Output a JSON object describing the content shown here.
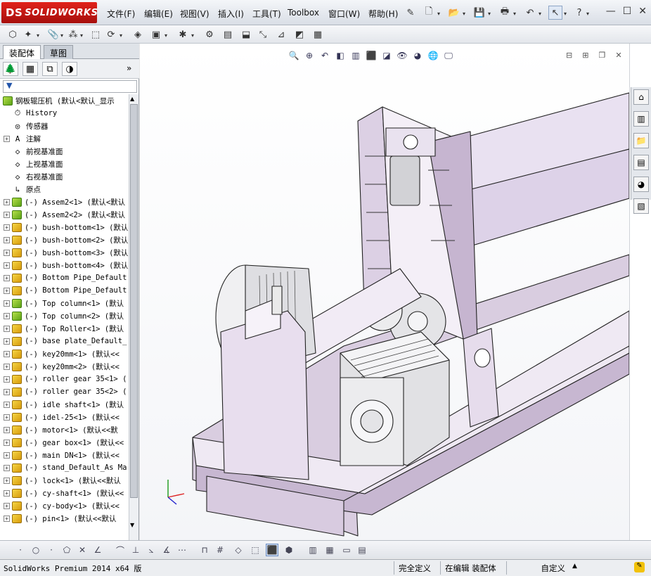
{
  "app": {
    "brand": "SOLIDWORKS",
    "brand_prefix": "DS",
    "accent": "#d51a14"
  },
  "menu": {
    "items": [
      {
        "label": "文件(F)"
      },
      {
        "label": "编辑(E)"
      },
      {
        "label": "视图(V)"
      },
      {
        "label": "插入(I)"
      },
      {
        "label": "工具(T)"
      },
      {
        "label": "Toolbox"
      },
      {
        "label": "窗口(W)"
      },
      {
        "label": "帮助(H)"
      }
    ]
  },
  "panel": {
    "tabs": [
      {
        "label": "装配体",
        "active": true
      },
      {
        "label": "草图",
        "active": false
      }
    ],
    "tree_root": "钢板辊压机 (默认<默认_显示",
    "tree": [
      {
        "label": "History",
        "icon": "history-icon",
        "expand": false
      },
      {
        "label": "传感器",
        "icon": "sensor-icon",
        "expand": false
      },
      {
        "label": "注解",
        "icon": "annotation-icon",
        "expand": true
      },
      {
        "label": "前视基准面",
        "icon": "plane-icon",
        "expand": false
      },
      {
        "label": "上视基准面",
        "icon": "plane-icon",
        "expand": false
      },
      {
        "label": "右视基准面",
        "icon": "plane-icon",
        "expand": false
      },
      {
        "label": "原点",
        "icon": "origin-icon",
        "expand": false
      },
      {
        "label": "(-) Assem2<1> (默认<默认",
        "icon": "asm",
        "expand": true
      },
      {
        "label": "(-) Assem2<2> (默认<默认",
        "icon": "asm",
        "expand": true
      },
      {
        "label": "(-) bush-bottom<1> (默认",
        "icon": "part",
        "expand": true
      },
      {
        "label": "(-) bush-bottom<2> (默认",
        "icon": "part",
        "expand": true
      },
      {
        "label": "(-) bush-bottom<3> (默认",
        "icon": "part",
        "expand": true
      },
      {
        "label": "(-) bush-bottom<4> (默认",
        "icon": "part",
        "expand": true
      },
      {
        "label": "(-) Bottom Pipe_Default",
        "icon": "part",
        "expand": true
      },
      {
        "label": "(-) Bottom Pipe_Default",
        "icon": "part",
        "expand": true
      },
      {
        "label": "(-) Top column<1> (默认",
        "icon": "asm",
        "expand": true
      },
      {
        "label": "(-) Top column<2> (默认",
        "icon": "asm",
        "expand": true
      },
      {
        "label": "(-) Top Roller<1> (默认",
        "icon": "part",
        "expand": true
      },
      {
        "label": "(-) base plate_Default_",
        "icon": "part",
        "expand": true
      },
      {
        "label": "(-) key20mm<1> (默认<<",
        "icon": "part",
        "expand": true
      },
      {
        "label": "(-) key20mm<2> (默认<<",
        "icon": "part",
        "expand": true
      },
      {
        "label": "(-) roller gear 35<1> (",
        "icon": "part",
        "expand": true
      },
      {
        "label": "(-) roller gear 35<2> (",
        "icon": "part",
        "expand": true
      },
      {
        "label": "(-) idle shaft<1> (默认",
        "icon": "part",
        "expand": true
      },
      {
        "label": "(-) idel-25<1> (默认<<",
        "icon": "part",
        "expand": true
      },
      {
        "label": "(-) motor<1> (默认<<默",
        "icon": "part",
        "expand": true
      },
      {
        "label": "(-) gear box<1> (默认<<",
        "icon": "part",
        "expand": true
      },
      {
        "label": "(-) main DN<1> (默认<<",
        "icon": "part",
        "expand": true
      },
      {
        "label": "(-) stand_Default_As Ma",
        "icon": "part",
        "expand": true
      },
      {
        "label": "(-) lock<1> (默认<<默认",
        "icon": "part",
        "expand": true
      },
      {
        "label": "(-) cy-shaft<1> (默认<<",
        "icon": "part",
        "expand": true
      },
      {
        "label": "(-) cy-body<1> (默认<<",
        "icon": "part",
        "expand": true
      },
      {
        "label": "(-) pin<1> (默认<<默认",
        "icon": "part",
        "expand": true
      }
    ]
  },
  "status": {
    "product": "SolidWorks Premium 2014 x64 版",
    "definition": "完全定义",
    "editing": "在编辑 装配体",
    "units": "自定义"
  },
  "colors": {
    "frame": "#ddd0e4",
    "frame_dark": "#b9a8c4",
    "edge": "#222222",
    "roller": "#e8dff0"
  }
}
